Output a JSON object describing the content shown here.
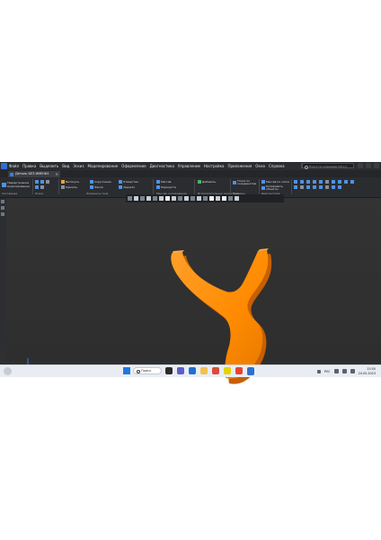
{
  "menubar": {
    "items": [
      "Файл",
      "Правка",
      "Выделить",
      "Вид",
      "Эскиз",
      "Моделирование",
      "Оформление",
      "Диагностика",
      "Управление",
      "Настройка",
      "Приложения",
      "Окно",
      "Справка"
    ],
    "search_placeholder": "Поиск по командам (Alt+/)"
  },
  "tabs": [
    {
      "label": "Деталь БЕЗ ИМЕНИ1"
    }
  ],
  "ribbon": {
    "main_button": "Твердотельное моделирование",
    "tool_labels": [
      "Вытянуть",
      "Удалить",
      "Скругление",
      "Фаска",
      "Отверстие",
      "Зеркало",
      "Массив",
      "Перенести",
      "Добавить",
      "Точка по координатам",
      "Массив по сетке",
      "Копировать объекты"
    ],
    "group_labels": [
      "Системная",
      "Эскиз",
      "Элементы тела",
      "Массив, копирование",
      "Вспомогательная геометрия",
      "Размеры",
      "Диагностика"
    ]
  },
  "taskbar": {
    "search_label": "Поиск",
    "lang": "РУС",
    "time": "13:50",
    "date": "24.05.2023"
  },
  "colors": {
    "model": "#ff8a00",
    "accent": "#2f6fd1"
  }
}
